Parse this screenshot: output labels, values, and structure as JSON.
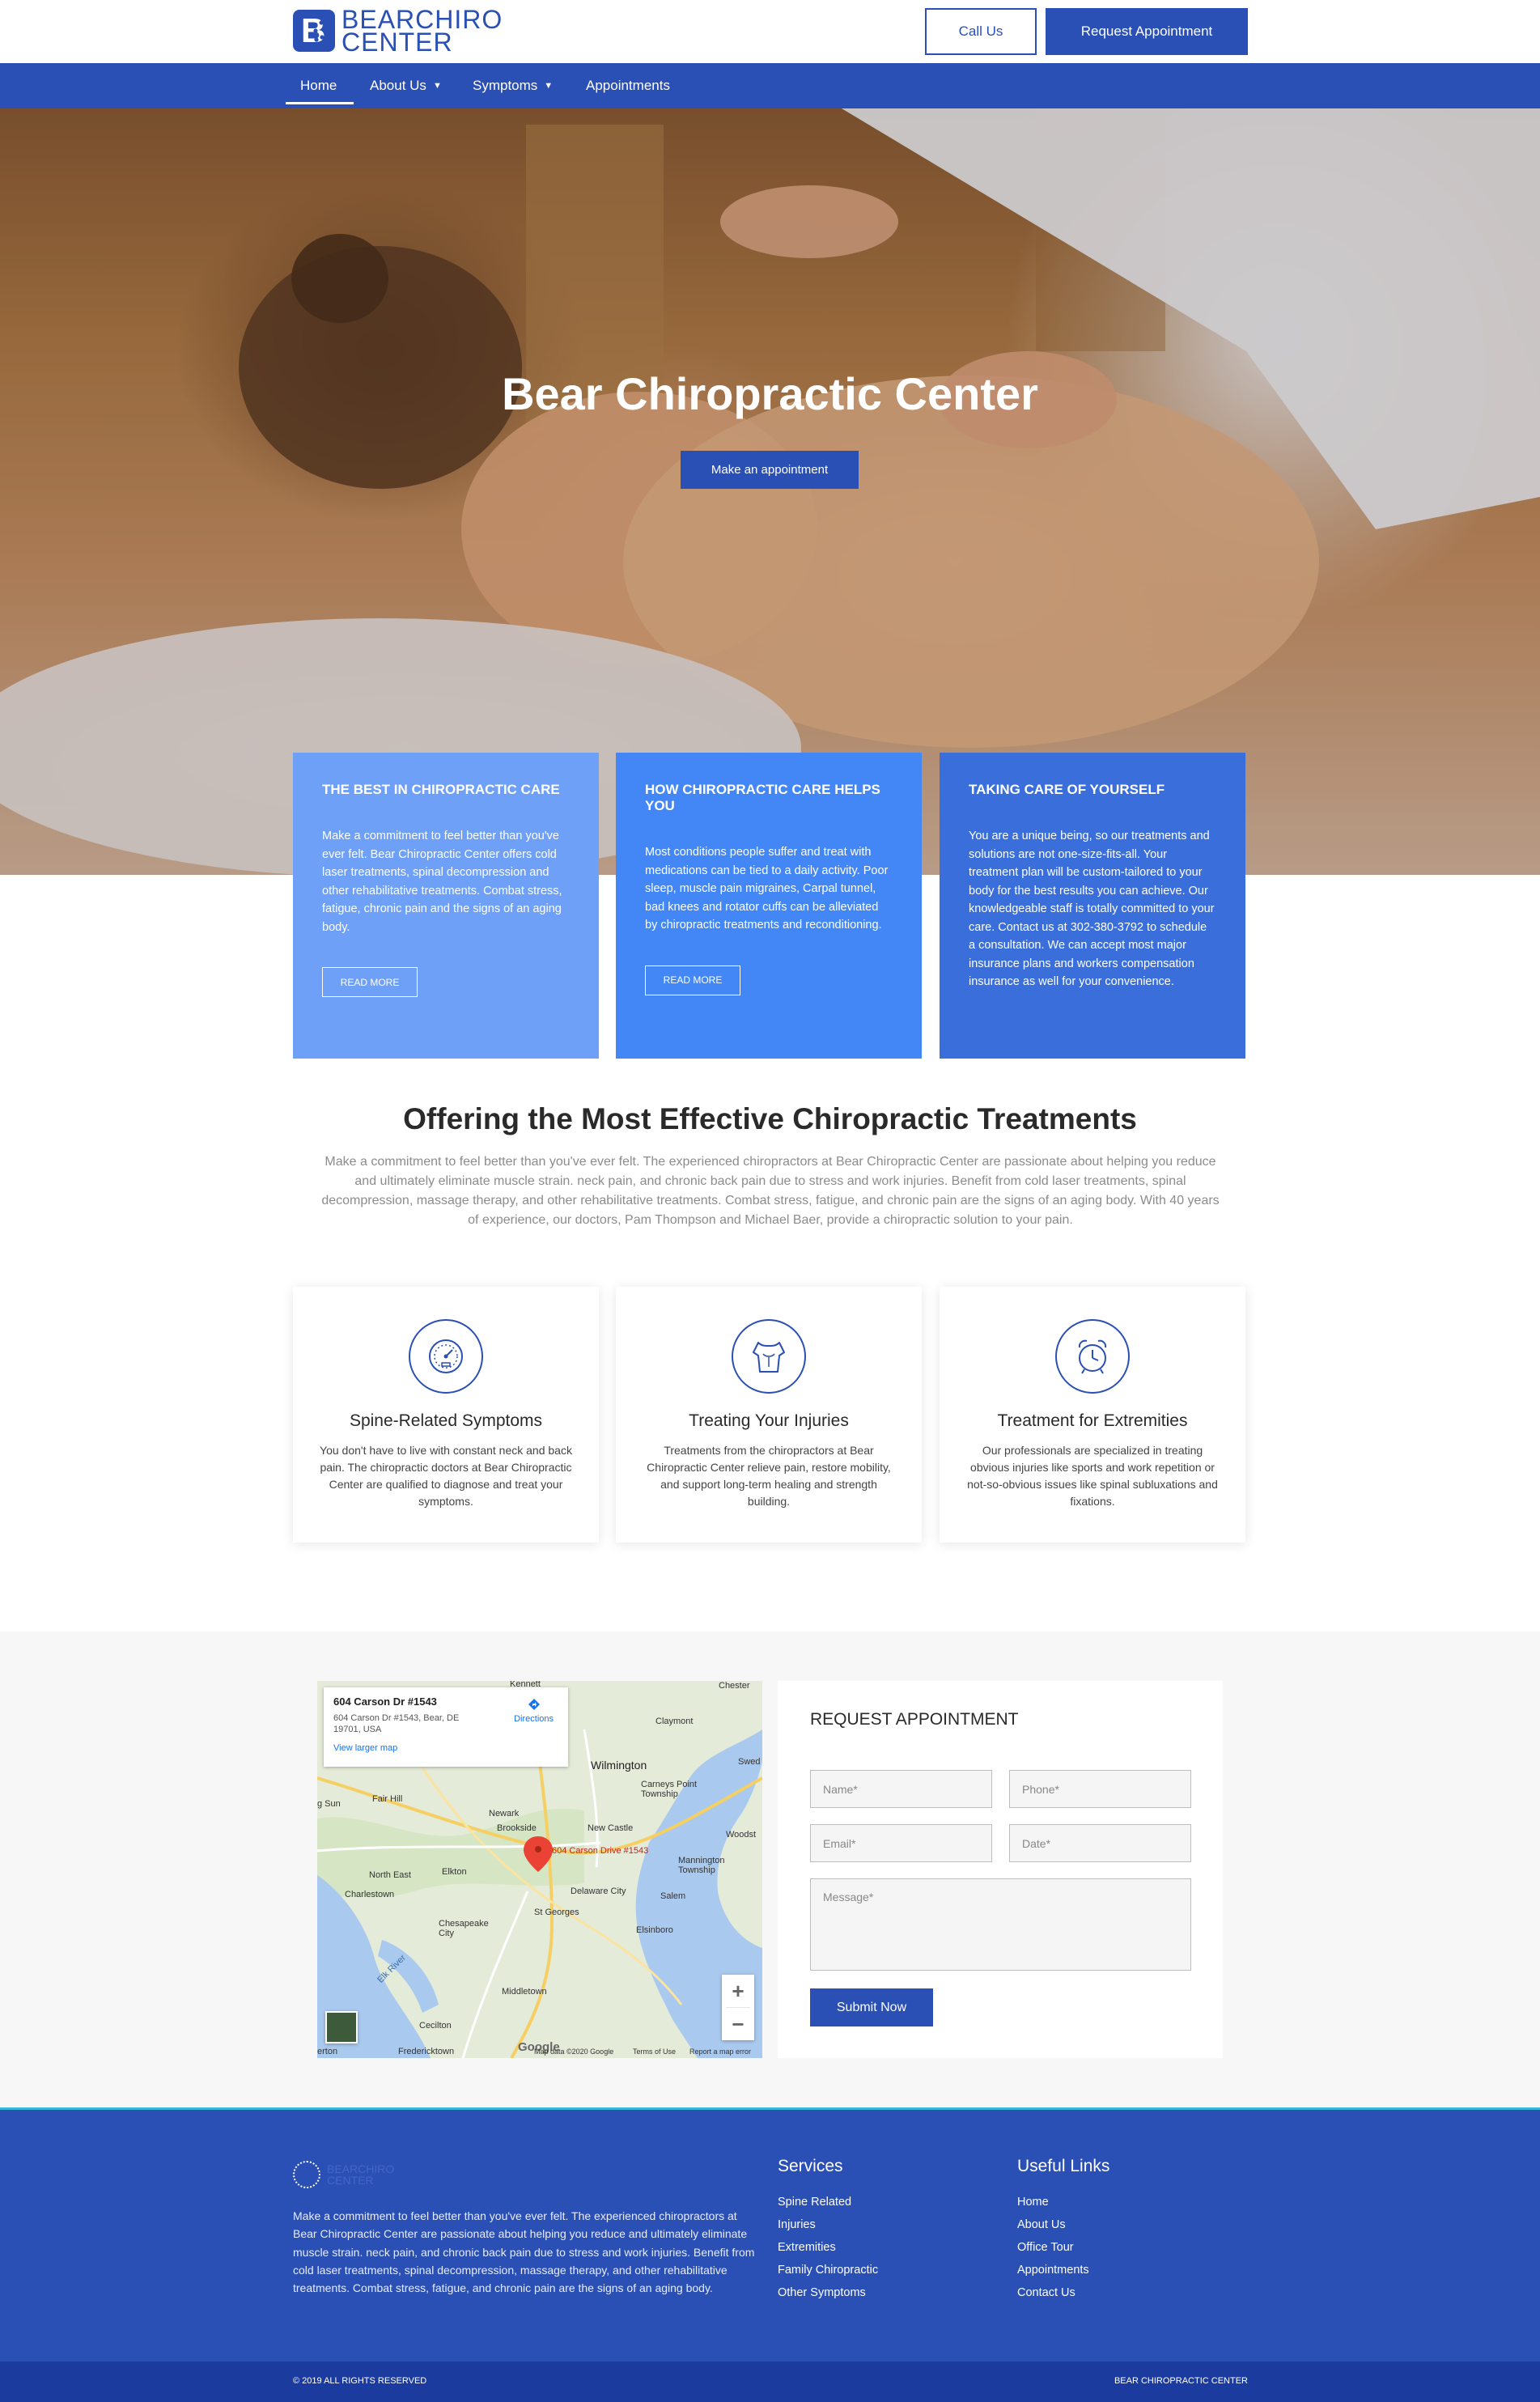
{
  "header": {
    "logo_line1": "BEARCHIRO",
    "logo_line2": "CENTER",
    "call_label": "Call Us",
    "request_label": "Request Appointment"
  },
  "nav": {
    "items": [
      {
        "label": "Home",
        "active": true,
        "dropdown": false
      },
      {
        "label": "About Us",
        "dropdown": true
      },
      {
        "label": "Symptoms",
        "dropdown": true
      },
      {
        "label": "Appointments",
        "dropdown": false
      }
    ]
  },
  "hero": {
    "title": "Bear Chiropractic Center",
    "button_label": "Make an appointment"
  },
  "features": [
    {
      "title": "THE BEST IN CHIROPRACTIC CARE",
      "text": "Make a commitment to feel better than you've ever felt. Bear Chiropractic Center offers cold laser treatments, spinal decompression and other rehabilitative treatments. Combat stress, fatigue, chronic pain and the signs of an aging body.",
      "button": "READ MORE",
      "color": "#6ea0f7"
    },
    {
      "title": "HOW CHIROPRACTIC CARE HELPS YOU",
      "text": "Most conditions people suffer and treat with medications can be tied to a daily activity. Poor sleep, muscle pain migraines, Carpal tunnel, bad knees and rotator cuffs can be alleviated by chiropractic treatments and reconditioning.",
      "button": "READ MORE",
      "color": "#4287f5"
    },
    {
      "title": "TAKING CARE OF YOURSELF",
      "text": "You are a unique being, so our treatments and solutions are not one-size-fits-all. Your treatment plan will be custom-tailored to your body for the best results you can achieve. Our knowledgeable staff is totally committed to your care. Contact us at 302-380-3792 to schedule a consultation. We can accept most major insurance plans and workers compensation insurance as well for your convenience.",
      "color": "#3a6fdb"
    }
  ],
  "offering": {
    "title": "Offering the Most Effective Chiropractic Treatments",
    "text": "Make a commitment to feel better than you've ever felt. The experienced chiropractors at Bear Chiropractic Center are passionate about helping you reduce and ultimately eliminate muscle strain. neck pain, and chronic back pain due to stress and work injuries. Benefit from cold laser treatments, spinal decompression, massage therapy, and other rehabilitative treatments. Combat stress, fatigue, and chronic pain are the signs of an aging body. With 40 years of experience, our doctors, Pam Thompson and Michael Baer, provide a chiropractic solution to your pain."
  },
  "services": [
    {
      "icon": "gauge-icon",
      "title": "Spine-Related Symptoms",
      "text": "You don't have to live with constant neck and back pain. The chiropractic doctors at Bear Chiropractic Center are qualified to diagnose and treat your symptoms."
    },
    {
      "icon": "torso-icon",
      "title": "Treating Your Injuries",
      "text": "Treatments from the chiropractors at Bear Chiropractic Center relieve pain, restore mobility, and support long-term healing and strength building."
    },
    {
      "icon": "alarm-clock-icon",
      "title": "Treatment for Extremities",
      "text": "Our professionals are specialized in treating obvious injuries like sports and work repetition or not-so-obvious issues like spinal subluxations and fixations."
    }
  ],
  "map": {
    "place_title": "604 Carson Dr #1543",
    "place_address": "604 Carson Dr #1543, Bear, DE 19701, USA",
    "larger_map": "View larger map",
    "directions": "Directions",
    "marker_label": "604 Carson Drive #1543",
    "attribution": "Map data ©2020 Google",
    "terms": "Terms of Use",
    "report": "Report a map error",
    "google": "Google",
    "labels": {
      "kennett": "Kennett",
      "chester": "Chester",
      "claymont": "Claymont",
      "wilmington": "Wilmington",
      "swedesboro": "Swed",
      "carneys_point": "Carneys Point Township",
      "newark": "Newark",
      "brookside": "Brookside",
      "new_castle": "New Castle",
      "fair_hill": "Fair Hill",
      "king_sun": "g Sun",
      "woodstown": "Woodst",
      "north_east": "North East",
      "elkton": "Elkton",
      "mannington": "Mannington Township",
      "charlestown": "Charlestown",
      "delaware_city": "Delaware City",
      "salem": "Salem",
      "chesapeake_city": "Chesapeake City",
      "st_georges": "St Georges",
      "elsinboro": "Elsinboro",
      "elk_river": "Elk River",
      "middletown": "Middletown",
      "cecilton": "Cecilton",
      "fredericktown": "Fredericktown",
      "erton": "erton"
    }
  },
  "form": {
    "title": "REQUEST APPOINTMENT",
    "name_placeholder": "Name*",
    "phone_placeholder": "Phone*",
    "email_placeholder": "Email*",
    "date_placeholder": "Date*",
    "message_placeholder": "Message*",
    "submit_label": "Submit Now"
  },
  "footer": {
    "about": "Make a commitment to feel better than you've ever felt. The experienced chiropractors at Bear Chiropractic Center are passionate about helping you reduce and ultimately eliminate muscle strain. neck pain, and chronic back pain due to stress and work injuries. Benefit from cold laser treatments, spinal decompression, massage therapy, and other rehabilitative treatments. Combat stress, fatigue, and chronic pain are the signs of an aging body.",
    "services_title": "Services",
    "services": [
      "Spine Related",
      "Injuries",
      "Extremities",
      "Family Chiropractic",
      "Other Symptoms"
    ],
    "links_title": "Useful Links",
    "links": [
      "Home",
      "About Us",
      "Office Tour",
      "Appointments",
      "Contact Us"
    ],
    "copyright": "© 2019 ALL RIGHTS RESERVED",
    "brand": "BEAR CHIROPRACTIC CENTER"
  },
  "colors": {
    "brand_blue": "#2a4fb5",
    "footer_bottom": "#1b3c9e",
    "accent_line": "#36b6d8"
  }
}
